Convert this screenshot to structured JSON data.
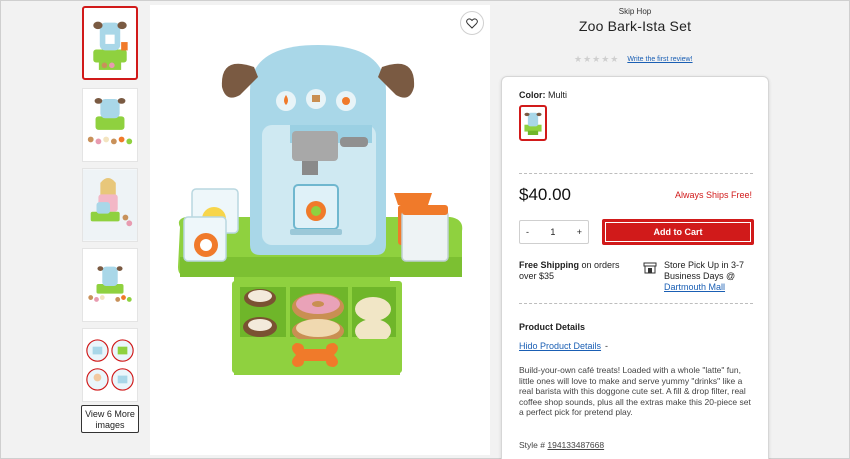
{
  "product": {
    "brand": "Skip Hop",
    "title": "Zoo Bark-Ista Set",
    "stars": "★★★★★",
    "review_link": "Write the first review!"
  },
  "gallery": {
    "more_button_line1": "View 6 More",
    "more_button_line2": "images"
  },
  "purchase": {
    "color_label": "Color:",
    "color_value": "Multi",
    "price": "$40.00",
    "ships_free": "Always Ships Free!",
    "qty_minus": "-",
    "qty_value": "1",
    "qty_plus": "+",
    "add_to_cart": "Add to Cart",
    "shipping_bold": "Free Shipping",
    "shipping_rest": " on orders over $35",
    "store_text": "Store Pick Up in 3-7 Business Days @",
    "store_link": "Dartmouth Mall"
  },
  "details": {
    "heading": "Product Details",
    "link": "Hido Product Details",
    "link_suffix": "-",
    "description": "Build-your-own café treats! Loaded with a whole \"latte\" fun, little ones will love to make and serve yummy \"drinks\" like a real barista with this doggone cute set. A fill & drop filter, real coffee shop sounds, plus all the extras make this 20-piece set a perfect pick for pretend play.",
    "style_label": "Style #",
    "style_number": "194133487668"
  },
  "colors": {
    "accent": "#d11a1a",
    "link": "#1a5fb4",
    "toy_blue": "#a9d7e8",
    "toy_green": "#8fd13f",
    "toy_brown": "#7a5a42"
  }
}
